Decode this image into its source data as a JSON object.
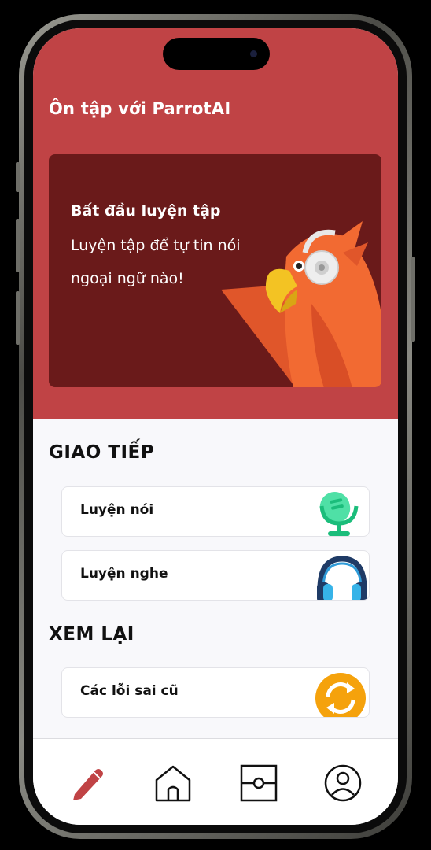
{
  "header": {
    "title": "Ôn tập với ParrotAI"
  },
  "hero": {
    "title": "Bất đầu luyện tập",
    "subtitle": "Luyện tập để tự tin nói ngoại ngữ nào!"
  },
  "sections": {
    "communication": {
      "title": "GIAO TIẾP",
      "items": [
        {
          "label": "Luyện nói",
          "icon": "microphone-icon"
        },
        {
          "label": "Luyện nghe",
          "icon": "headphones-icon"
        }
      ]
    },
    "review": {
      "title": "XEM LẠI",
      "items": [
        {
          "label": "Các lỗi sai cũ",
          "icon": "refresh-icon"
        }
      ]
    }
  },
  "nav": {
    "items": [
      {
        "icon": "pencil-icon",
        "active": true
      },
      {
        "icon": "home-icon",
        "active": false
      },
      {
        "icon": "board-icon",
        "active": false
      },
      {
        "icon": "profile-icon",
        "active": false
      }
    ]
  },
  "colors": {
    "header_bg": "#c04345",
    "hero_bg": "#6a1a1a",
    "active_nav": "#c04345",
    "accent_green": "#2ec98a",
    "accent_orange": "#f59e0b"
  }
}
